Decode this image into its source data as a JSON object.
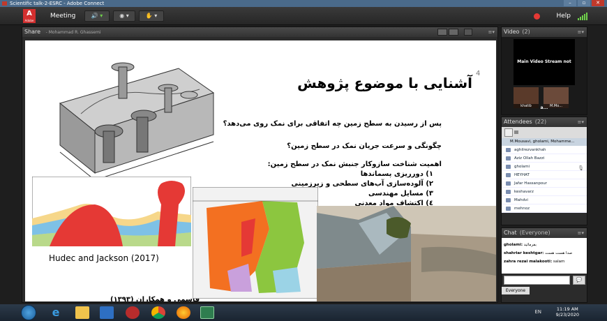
{
  "window": {
    "title": "Scientific talk-2-ESRC - Adobe Connect"
  },
  "toolbar": {
    "logo_text": "A",
    "logo_sub": "Adobe",
    "meeting_label": "Meeting",
    "help_label": "Help"
  },
  "share": {
    "title": "Share",
    "presenter": "- Mohammad R. Ghassemi",
    "slide": {
      "number": "4",
      "title": "آشنایی با موضوع پژوهش",
      "q1": "پس از رسیدن به سطح زمین چه اتفاقی برای نمک روی می‌دهد؟",
      "q2": "چگونگی و سرعت جریان نمک در سطح زمین؟",
      "importance": "اهمیت شناخت سازوکار جنبش نمک در سطح زمین:",
      "items": [
        "۱) دورریزی پسماندها",
        "۲) آلوده‌سازی آب‌های سطحی و زیرزمینی",
        "۳) مسایل مهندسی",
        "٤) اکتشاف مواد معدنی"
      ],
      "citation_en": "Hudec and Jackson (2017)",
      "citation_fa": "قاسمی و همکاران (۱۳۹۳)"
    }
  },
  "video": {
    "title": "Video",
    "count": "(2)",
    "stream_text": "Main Video Stream not a...",
    "thumbs": [
      "khatib",
      "M.Mo..."
    ]
  },
  "attendees": {
    "title": "Attendees",
    "count": "(22)",
    "group": "M.Mousavi, gholami, Mohamme...",
    "list": [
      "aghilrezvankhah",
      "Aziz Ollah Bazzi",
      "gholami",
      "HEYHAT",
      "Jafar Hassanpour",
      "keshavarz",
      "Mahdvi",
      "mehnoz"
    ]
  },
  "chat": {
    "title": "Chat",
    "scope": "(Everyone)",
    "messages": [
      {
        "from": "gholami:",
        "text": "بفرمائید"
      },
      {
        "from": "shahriar keshtgar:",
        "text": "صدا هست هست"
      },
      {
        "from": "zahra rezai malakooti:",
        "text": "salam"
      }
    ],
    "tab": "Everyone"
  },
  "taskbar": {
    "lang": "EN",
    "time": "11:19 AM",
    "date": "9/23/2020"
  }
}
